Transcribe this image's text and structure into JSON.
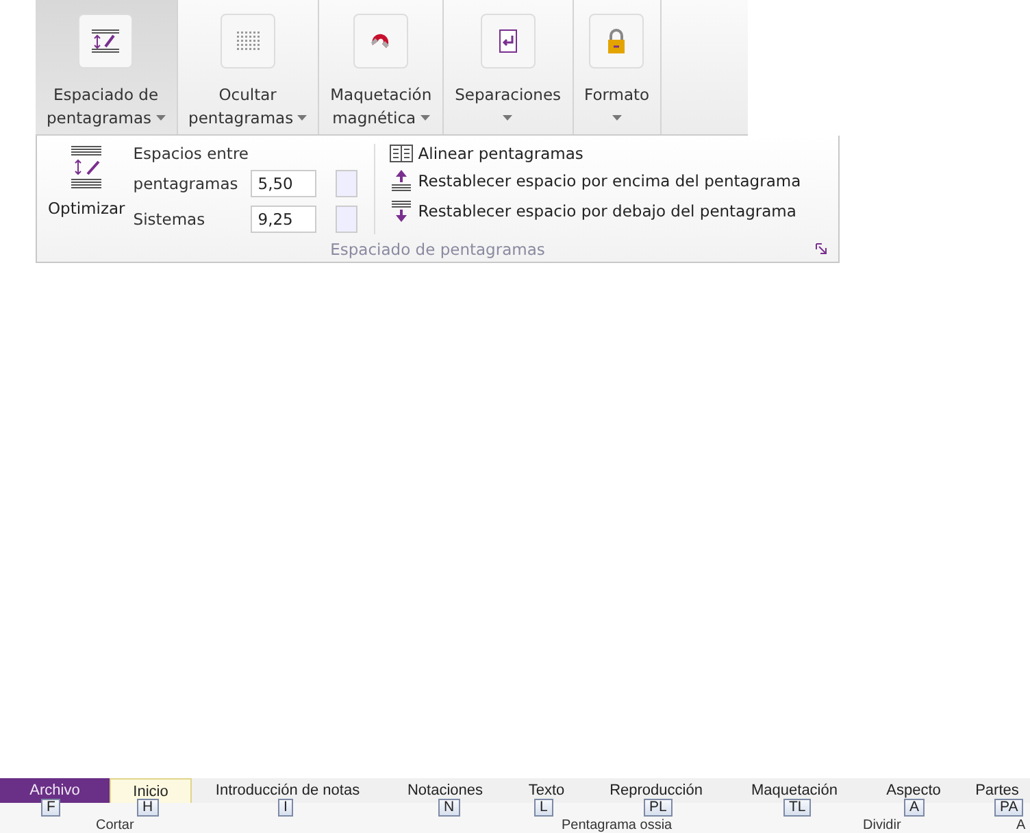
{
  "ribbon_buttons": [
    {
      "lines": [
        "Espaciado de",
        "pentagramas"
      ],
      "kind": "spacing",
      "selected": true
    },
    {
      "lines": [
        "Ocultar",
        "pentagramas"
      ],
      "kind": "hide",
      "selected": false
    },
    {
      "lines": [
        "Maquetación",
        "magnética"
      ],
      "kind": "magnet",
      "selected": false
    },
    {
      "lines": [
        "Separaciones"
      ],
      "kind": "breaks",
      "selected": false
    },
    {
      "lines": [
        "Formato"
      ],
      "kind": "lock",
      "selected": false
    }
  ],
  "panel": {
    "optimize_button": "Optimizar",
    "spacing_heading": "Espacios entre",
    "fields": [
      {
        "label": "pentagramas",
        "value": "5,50"
      },
      {
        "label": "Sistemas",
        "value": "9,25"
      }
    ],
    "commands": [
      {
        "label": "Alinear pentagramas",
        "kind": "align"
      },
      {
        "label": "Restablecer espacio por encima del pentagrama",
        "kind": "above"
      },
      {
        "label": "Restablecer espacio por debajo del pentagrama",
        "kind": "below"
      }
    ],
    "group_label": "Espaciado de pentagramas"
  },
  "tabs": [
    {
      "label": "Archivo",
      "kind": "file",
      "selected": false,
      "key_tip": "F"
    },
    {
      "label": "Inicio",
      "kind": "tab",
      "selected": true,
      "key_tip": "H"
    },
    {
      "label": "Introducción de notas",
      "kind": "tab",
      "selected": false,
      "key_tip": "I"
    },
    {
      "label": "Notaciones",
      "kind": "tab",
      "selected": false,
      "key_tip": "N"
    },
    {
      "label": "Texto",
      "kind": "tab",
      "selected": false,
      "key_tip": "L"
    },
    {
      "label": "Reproducción",
      "kind": "tab",
      "selected": false,
      "key_tip": "PL"
    },
    {
      "label": "Maquetación",
      "kind": "tab",
      "selected": false,
      "key_tip": "TL"
    },
    {
      "label": "Aspecto",
      "kind": "tab",
      "selected": false,
      "key_tip": "A"
    },
    {
      "label": "Partes",
      "kind": "tab",
      "selected": false,
      "key_tip": "PA"
    }
  ],
  "command_row": [
    "Cortar",
    "Pentagrama ossia",
    "Dividir",
    "A"
  ]
}
